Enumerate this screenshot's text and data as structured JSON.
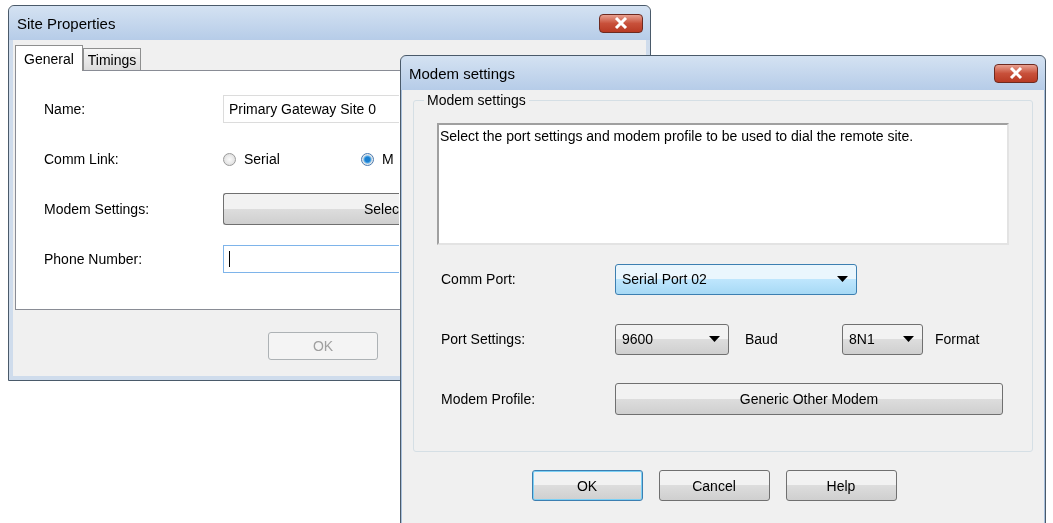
{
  "site_window": {
    "title": "Site Properties",
    "tabs": [
      {
        "label": "General",
        "selected": true
      },
      {
        "label": "Timings",
        "selected": false
      }
    ],
    "name": {
      "label": "Name:",
      "value": "Primary Gateway Site 0"
    },
    "comm_link": {
      "label": "Comm Link:",
      "options": [
        {
          "label": "Serial",
          "selected": false
        },
        {
          "label": "M",
          "selected": true
        }
      ]
    },
    "modem_settings": {
      "label": "Modem Settings:",
      "button": "Selec"
    },
    "phone": {
      "label": "Phone Number:",
      "focused": true
    },
    "buttons": [
      {
        "label": "OK",
        "disabled": true
      }
    ]
  },
  "modem_window": {
    "title": "Modem settings",
    "group_title": "Modem settings",
    "description": "Select the port settings and modem profile to be used to dial the remote site.",
    "comm_port": {
      "label": "Comm Port:",
      "value": "Serial Port 02",
      "focused": true
    },
    "port_settings": {
      "label": "Port Settings:",
      "baud": "9600",
      "baud_unit": "Baud",
      "format": "8N1",
      "format_unit": "Format"
    },
    "modem_profile": {
      "label": "Modem Profile:",
      "button": "Generic Other Modem"
    },
    "buttons": [
      {
        "label": "OK",
        "default": true
      },
      {
        "label": "Cancel",
        "default": false
      },
      {
        "label": "Help",
        "default": false
      }
    ]
  }
}
